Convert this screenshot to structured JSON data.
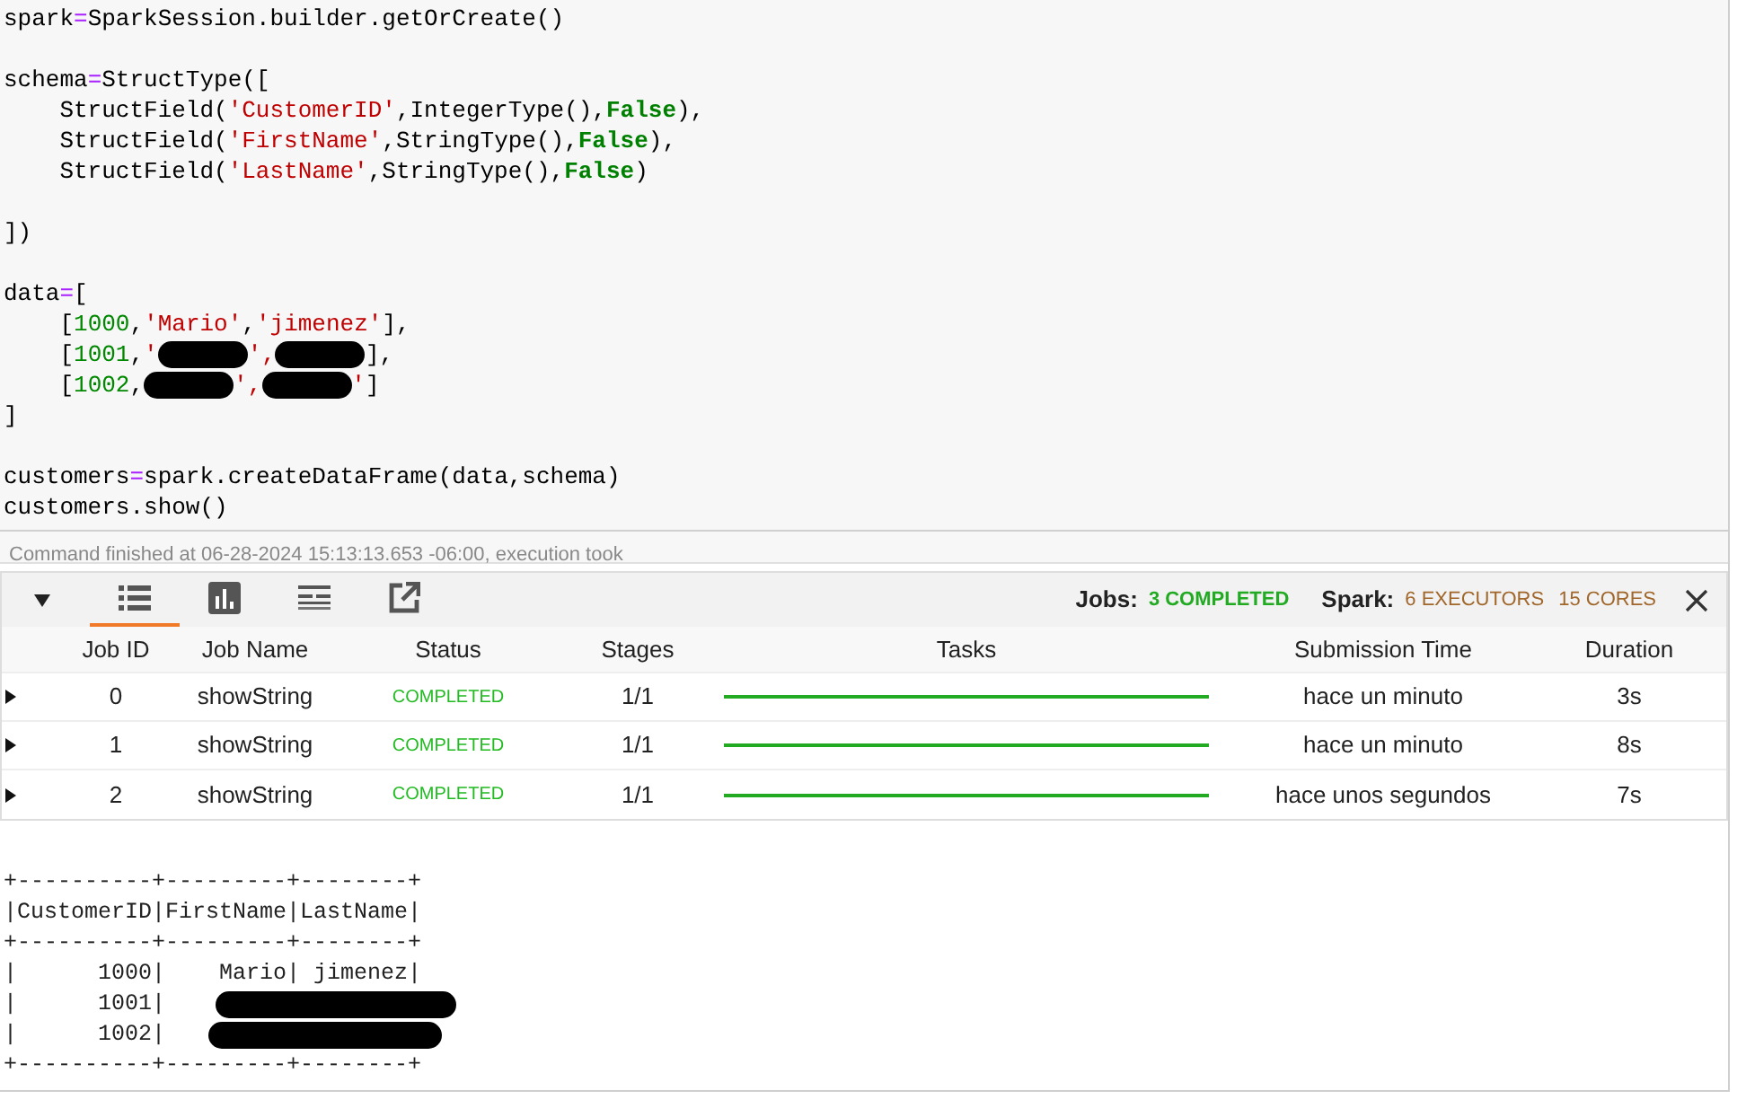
{
  "code_cell": {
    "lines": [
      {
        "tokens": [
          {
            "t": "spark",
            "kind": "plain"
          },
          {
            "t": "=",
            "kind": "op"
          },
          {
            "t": "SparkSession.builder.getOrCreate()",
            "kind": "plain"
          }
        ]
      },
      {
        "space_before": true,
        "tokens": [
          {
            "t": "schema",
            "kind": "plain"
          },
          {
            "t": "=",
            "kind": "op"
          },
          {
            "t": "StructType([",
            "kind": "plain"
          }
        ]
      },
      {
        "tokens": [
          {
            "t": "    StructField(",
            "kind": "plain"
          },
          {
            "t": "'CustomerID'",
            "kind": "str"
          },
          {
            "t": ",IntegerType(),",
            "kind": "plain"
          },
          {
            "t": "False",
            "kind": "kw"
          },
          {
            "t": "),",
            "kind": "plain"
          }
        ]
      },
      {
        "tokens": [
          {
            "t": "    StructField(",
            "kind": "plain"
          },
          {
            "t": "'FirstName'",
            "kind": "str"
          },
          {
            "t": ",StringType(),",
            "kind": "plain"
          },
          {
            "t": "False",
            "kind": "kw"
          },
          {
            "t": "),",
            "kind": "plain"
          }
        ]
      },
      {
        "tokens": [
          {
            "t": "    StructField(",
            "kind": "plain"
          },
          {
            "t": "'LastName'",
            "kind": "str"
          },
          {
            "t": ",StringType(),",
            "kind": "plain"
          },
          {
            "t": "False",
            "kind": "kw"
          },
          {
            "t": ")",
            "kind": "plain"
          }
        ]
      },
      {
        "space_before": true,
        "tokens": [
          {
            "t": "])",
            "kind": "plain"
          }
        ]
      },
      {
        "space_before": true,
        "tokens": [
          {
            "t": "data",
            "kind": "plain"
          },
          {
            "t": "=",
            "kind": "op"
          },
          {
            "t": "[",
            "kind": "plain"
          }
        ]
      },
      {
        "tokens": [
          {
            "t": "    [",
            "kind": "plain"
          },
          {
            "t": "1000",
            "kind": "num"
          },
          {
            "t": ",",
            "kind": "plain"
          },
          {
            "t": "'Mario'",
            "kind": "str"
          },
          {
            "t": ",",
            "kind": "plain"
          },
          {
            "t": "'jimenez'",
            "kind": "str"
          },
          {
            "t": "],",
            "kind": "plain"
          }
        ]
      },
      {
        "tokens": [
          {
            "t": "    [",
            "kind": "plain"
          },
          {
            "t": "1001",
            "kind": "num"
          },
          {
            "t": ",",
            "kind": "plain"
          },
          {
            "t": "'",
            "kind": "str"
          },
          {
            "kind": "redacted"
          },
          {
            "t": "',",
            "kind": "str"
          },
          {
            "kind": "redacted"
          },
          {
            "t": "],",
            "kind": "plain"
          }
        ]
      },
      {
        "tokens": [
          {
            "t": "    [",
            "kind": "plain"
          },
          {
            "t": "1002",
            "kind": "num"
          },
          {
            "t": ",",
            "kind": "plain"
          },
          {
            "kind": "redacted"
          },
          {
            "t": "',",
            "kind": "str"
          },
          {
            "kind": "redacted"
          },
          {
            "t": "'",
            "kind": "str"
          },
          {
            "t": "]",
            "kind": "plain"
          }
        ]
      },
      {
        "tokens": [
          {
            "t": "]",
            "kind": "plain"
          }
        ]
      },
      {
        "space_before": true,
        "tokens": [
          {
            "t": "customers",
            "kind": "plain"
          },
          {
            "t": "=",
            "kind": "op"
          },
          {
            "t": "spark.createDataFrame(data,schema)",
            "kind": "plain"
          }
        ]
      },
      {
        "tokens": [
          {
            "t": "customers.show()",
            "kind": "plain"
          }
        ]
      }
    ],
    "status": "Command finished at 06-28-2024 15:13:13.653 -06:00, execution took"
  },
  "jobs_panel": {
    "views": [
      {
        "kind": "list",
        "selected": true
      },
      {
        "kind": "chart",
        "selected": false
      },
      {
        "kind": "timeline",
        "selected": false
      },
      {
        "kind": "popout",
        "selected": false
      }
    ],
    "summary": {
      "jobs_label": "Jobs:",
      "jobs_value": "3 COMPLETED",
      "spark_label": "Spark:",
      "executors": "6 EXECUTORS",
      "cores": "15 CORES"
    },
    "columns": [
      "Job ID",
      "Job Name",
      "Status",
      "Stages",
      "Tasks",
      "Submission Time",
      "Duration"
    ],
    "rows": [
      {
        "id": "0",
        "name": "showString",
        "status": "COMPLETED",
        "stages": "1/1",
        "level": 1,
        "submitted": "hace un minuto",
        "duration": "3s"
      },
      {
        "id": "1",
        "name": "showString",
        "status": "COMPLETED",
        "stages": "1/1",
        "level": 1,
        "submitted": "hace un minuto",
        "duration": "8s"
      },
      {
        "id": "2",
        "name": "showString",
        "status": "COMPLETED",
        "stages": "1/1",
        "level": 1,
        "submitted": "hace unos segundos",
        "duration": "7s"
      }
    ]
  },
  "output": {
    "lines": [
      {
        "text": "+----------+---------+--------+",
        "kind": "plain"
      },
      {
        "text": "|CustomerID|FirstName|LastName|",
        "kind": "plain"
      },
      {
        "text": "+----------+---------+--------+",
        "kind": "plain"
      },
      {
        "text": "|      1000|    Mario| jimenez|",
        "kind": "plain"
      },
      {
        "text": "|      1001|",
        "kind": "redacted"
      },
      {
        "text": "|      1002|",
        "kind": "redacted"
      },
      {
        "text": "+----------+---------+--------+",
        "kind": "plain"
      }
    ]
  }
}
